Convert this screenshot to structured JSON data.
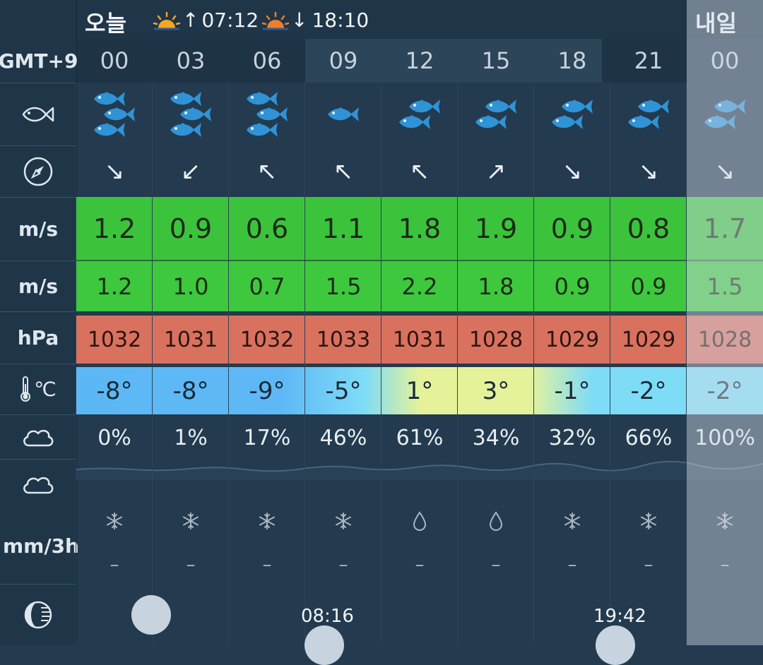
{
  "header": {
    "today_label": "오늘",
    "sunrise_time": "07:12",
    "sunset_time": "18:10",
    "tomorrow_label": "내일",
    "close_icon": "close-icon"
  },
  "labels": {
    "timezone": "GMT+9",
    "fish_icon": "fish-icon",
    "wind_dir_icon": "compass-icon",
    "wind_unit": "m/s",
    "gust_unit": "m/s",
    "pressure_unit": "hPa",
    "temp_unit": "℃",
    "cloud_icon": "cloud-icon",
    "precip_unit": "mm/3h",
    "moon_icon": "moon-phase-icon"
  },
  "columns": [
    {
      "hour": "00",
      "fish": 3,
      "wind_dir": "↘",
      "wind": "1.2",
      "gust": "1.2",
      "pressure": "1032",
      "temp": "-8°",
      "cloud": "0%",
      "precip_type": "snow",
      "precip": "–"
    },
    {
      "hour": "03",
      "fish": 3,
      "wind_dir": "↙",
      "wind": "0.9",
      "gust": "1.0",
      "pressure": "1031",
      "temp": "-8°",
      "cloud": "1%",
      "precip_type": "snow",
      "precip": "–"
    },
    {
      "hour": "06",
      "fish": 3,
      "wind_dir": "↖",
      "wind": "0.6",
      "gust": "0.7",
      "pressure": "1032",
      "temp": "-9°",
      "cloud": "17%",
      "precip_type": "snow",
      "precip": "–"
    },
    {
      "hour": "09",
      "fish": 1,
      "wind_dir": "↖",
      "wind": "1.1",
      "gust": "1.5",
      "pressure": "1033",
      "temp": "-5°",
      "cloud": "46%",
      "precip_type": "snow",
      "precip": "–"
    },
    {
      "hour": "12",
      "fish": 2,
      "wind_dir": "↖",
      "wind": "1.8",
      "gust": "2.2",
      "pressure": "1031",
      "temp": "1°",
      "cloud": "61%",
      "precip_type": "rain",
      "precip": "–"
    },
    {
      "hour": "15",
      "fish": 2,
      "wind_dir": "↗",
      "wind": "1.9",
      "gust": "1.8",
      "pressure": "1028",
      "temp": "3°",
      "cloud": "34%",
      "precip_type": "rain",
      "precip": "–"
    },
    {
      "hour": "18",
      "fish": 2,
      "wind_dir": "↘",
      "wind": "0.9",
      "gust": "0.9",
      "pressure": "1029",
      "temp": "-1°",
      "cloud": "32%",
      "precip_type": "snow",
      "precip": "–"
    },
    {
      "hour": "21",
      "fish": 2,
      "wind_dir": "↘",
      "wind": "0.8",
      "gust": "0.9",
      "pressure": "1029",
      "temp": "-2°",
      "cloud": "66%",
      "precip_type": "snow",
      "precip": "–"
    },
    {
      "hour": "00",
      "fish": 2,
      "wind_dir": "↘",
      "wind": "1.7",
      "gust": "1.5",
      "pressure": "1028",
      "temp": "-2°",
      "cloud": "100%",
      "precip_type": "snow",
      "precip": "–"
    }
  ],
  "moon": {
    "moonrise_time": "08:16",
    "moonset_time": "19:42"
  },
  "colors": {
    "wind_green": "#3cc33c",
    "pressure_red": "#d9715f",
    "temp_blue": "#5cb8f5",
    "temp_cyan": "#7fdcf7",
    "temp_yellow": "#e5f29a",
    "fish_blue": "#2f93d6"
  }
}
